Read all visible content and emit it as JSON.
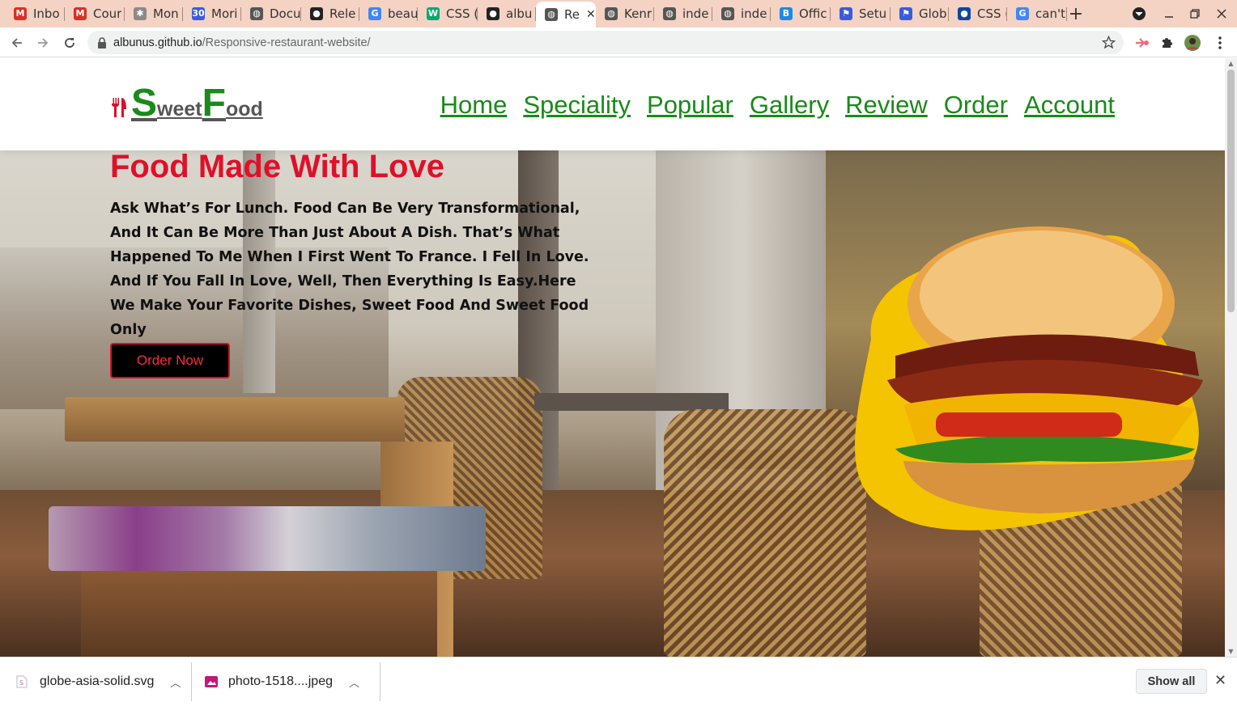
{
  "browser": {
    "tabs": [
      {
        "label": "Inbo",
        "icon": "gmail-icon",
        "color": "#d93025",
        "glyph": "M"
      },
      {
        "label": "Cour",
        "icon": "gmail-icon",
        "color": "#d93025",
        "glyph": "M"
      },
      {
        "label": "Mon",
        "icon": "tree-icon",
        "color": "#8a8a8a",
        "glyph": "✱"
      },
      {
        "label": "Mori",
        "icon": "calendar-icon",
        "color": "#3b5bdb",
        "glyph": "30"
      },
      {
        "label": "Docu",
        "icon": "globe-icon",
        "color": "#555555",
        "glyph": "◍"
      },
      {
        "label": "Rele",
        "icon": "github-icon",
        "color": "#222222",
        "glyph": "●"
      },
      {
        "label": "beau",
        "icon": "google-icon",
        "color": "#4285f4",
        "glyph": "G"
      },
      {
        "label": "CSS (",
        "icon": "w3schools-icon",
        "color": "#04aa6d",
        "glyph": "W"
      },
      {
        "label": "albu",
        "icon": "github-icon",
        "color": "#222222",
        "glyph": "●"
      },
      {
        "label": "Re",
        "icon": "globe-icon",
        "color": "#555555",
        "glyph": "◍",
        "active": true
      },
      {
        "label": "Kenr",
        "icon": "globe-icon",
        "color": "#555555",
        "glyph": "◍"
      },
      {
        "label": "inde",
        "icon": "globe-icon",
        "color": "#555555",
        "glyph": "◍"
      },
      {
        "label": "inde",
        "icon": "globe-icon",
        "color": "#555555",
        "glyph": "◍"
      },
      {
        "label": "Offic",
        "icon": "bootstrap-icon",
        "color": "#1e88e5",
        "glyph": "B"
      },
      {
        "label": "Setu",
        "icon": "flag-icon",
        "color": "#3b5bdb",
        "glyph": "⚑"
      },
      {
        "label": "Glob",
        "icon": "flag-icon",
        "color": "#3b5bdb",
        "glyph": "⚑"
      },
      {
        "label": "CSS (",
        "icon": "edge-icon",
        "color": "#0d47a1",
        "glyph": "●"
      },
      {
        "label": "can't",
        "icon": "google-icon",
        "color": "#4285f4",
        "glyph": "G"
      }
    ],
    "new_tab_label": "+",
    "url_host": "albunus.github.io",
    "url_path": "/Responsive-restaurant-website/"
  },
  "site": {
    "logo": {
      "big1": "S",
      "small1": "weet",
      "big2": "F",
      "small2": "ood"
    },
    "nav": [
      "Home",
      "Speciality",
      "Popular",
      "Gallery",
      "Review",
      "Order",
      "Account"
    ],
    "hero": {
      "title": "Food Made With Love",
      "text": "Ask What’s For Lunch. Food Can Be Very Transformational, And It Can Be More Than Just About A Dish. That’s What Happened To Me When I First Went To France. I Fell In Love. And If You Fall In Love, Well, Then Everything Is Easy.Here We Make Your Favorite Dishes, Sweet Food And Sweet Food Only",
      "button": "Order Now"
    },
    "colors": {
      "accent_green": "#1a8a1a",
      "accent_red": "#e0102a"
    }
  },
  "downloads": {
    "items": [
      {
        "name": "globe-asia-solid.svg",
        "icon": "svg-file-icon"
      },
      {
        "name": "photo-1518....jpeg",
        "icon": "image-file-icon"
      }
    ],
    "show_all": "Show all"
  }
}
